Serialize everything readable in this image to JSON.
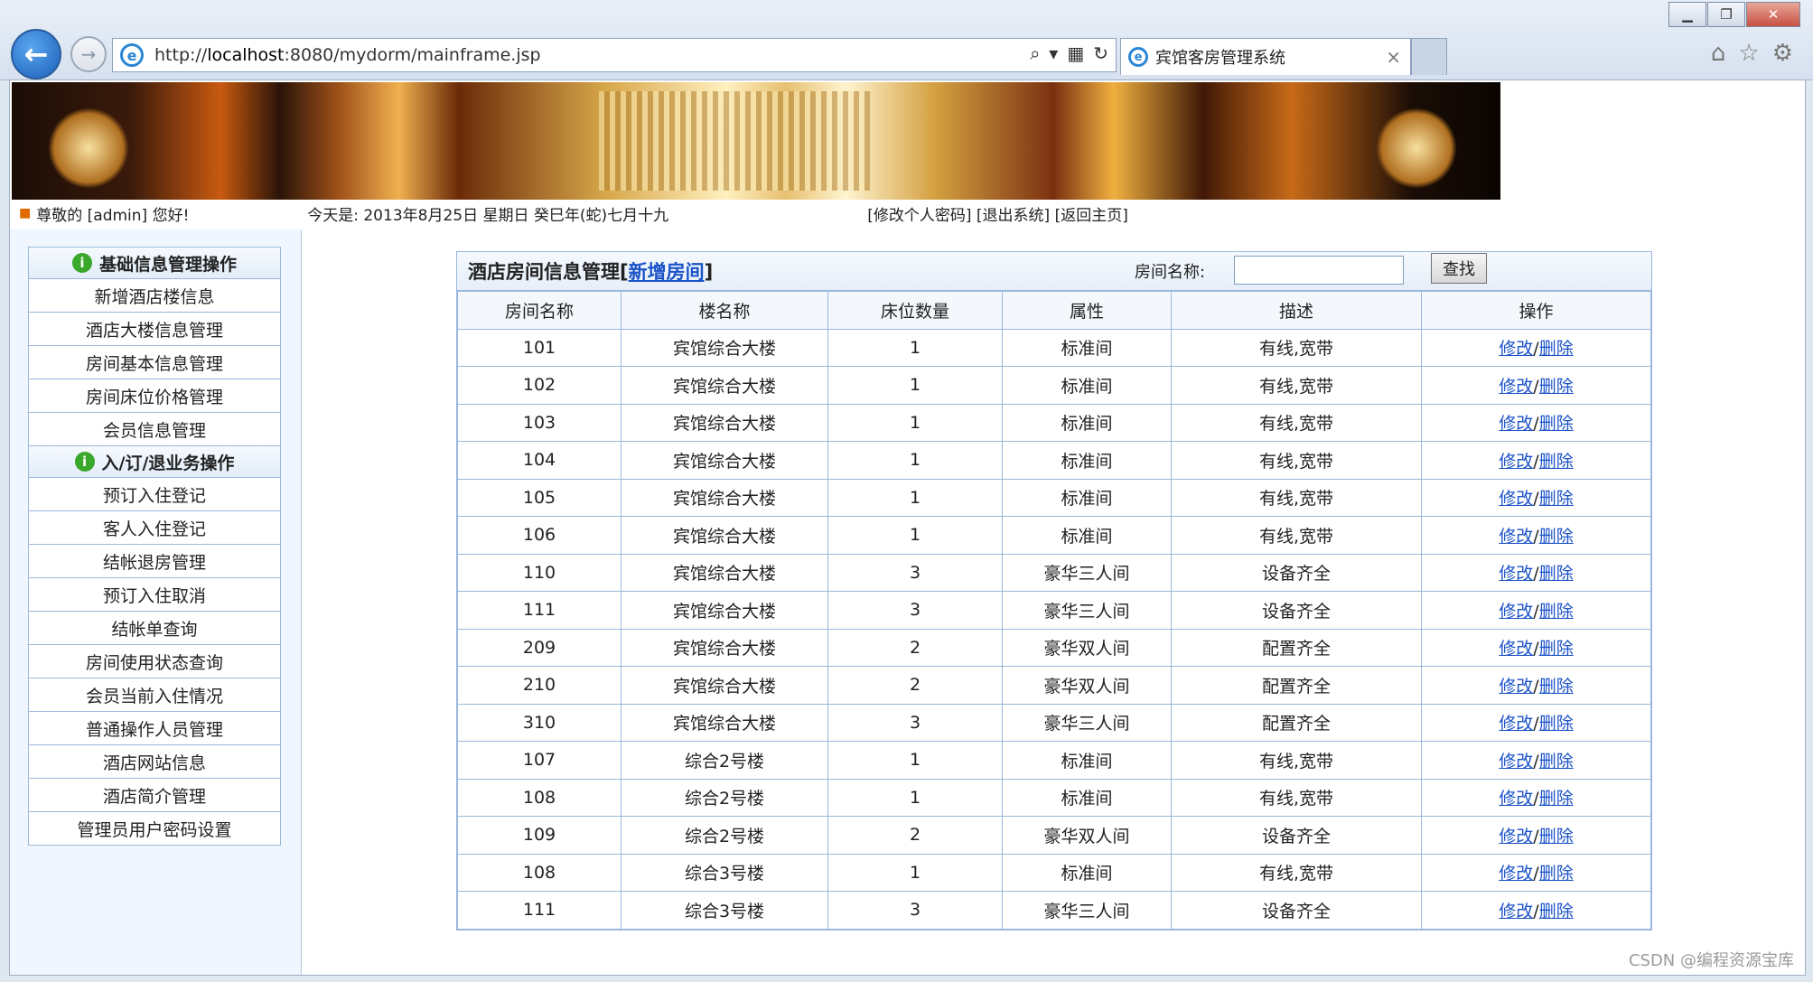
{
  "browser": {
    "url_prefix": "http://",
    "url_host": "localhost",
    "url_rest": ":8080/mydorm/mainframe.jsp",
    "tab_title": "宾馆客房管理系统",
    "tab_close": "×",
    "window_min": "▁",
    "window_max": "❐",
    "window_close": "✕"
  },
  "statusbar": {
    "greeting": "尊敬的 [admin] 您好!",
    "date": "今天是: 2013年8月25日 星期日 癸巳年(蛇)七月十九",
    "links": "[修改个人密码] [退出系统] [返回主页]"
  },
  "sidebar": {
    "section1_title": "基础信息管理操作",
    "section1_items": [
      "新增酒店楼信息",
      "酒店大楼信息管理",
      "房间基本信息管理",
      "房间床位价格管理",
      "会员信息管理"
    ],
    "section2_title": "入/订/退业务操作",
    "section2_items": [
      "预订入住登记",
      "客人入住登记",
      "结帐退房管理",
      "预订入住取消",
      "结帐单查询",
      "房间使用状态查询",
      "会员当前入住情况",
      "普通操作人员管理",
      "酒店网站信息",
      "酒店简介管理",
      "管理员用户密码设置"
    ]
  },
  "main": {
    "title": "酒店房间信息管理",
    "add_link": "新增房间",
    "bracket_open": "[",
    "bracket_close": "]",
    "search_label": "房间名称:",
    "search_button": "查找",
    "columns": [
      "房间名称",
      "楼名称",
      "床位数量",
      "属性",
      "描述",
      "操作"
    ],
    "edit_label": "修改",
    "delete_label": "删除",
    "rows": [
      [
        "101",
        "宾馆综合大楼",
        "1",
        "标准间",
        "有线,宽带"
      ],
      [
        "102",
        "宾馆综合大楼",
        "1",
        "标准间",
        "有线,宽带"
      ],
      [
        "103",
        "宾馆综合大楼",
        "1",
        "标准间",
        "有线,宽带"
      ],
      [
        "104",
        "宾馆综合大楼",
        "1",
        "标准间",
        "有线,宽带"
      ],
      [
        "105",
        "宾馆综合大楼",
        "1",
        "标准间",
        "有线,宽带"
      ],
      [
        "106",
        "宾馆综合大楼",
        "1",
        "标准间",
        "有线,宽带"
      ],
      [
        "110",
        "宾馆综合大楼",
        "3",
        "豪华三人间",
        "设备齐全"
      ],
      [
        "111",
        "宾馆综合大楼",
        "3",
        "豪华三人间",
        "设备齐全"
      ],
      [
        "209",
        "宾馆综合大楼",
        "2",
        "豪华双人间",
        "配置齐全"
      ],
      [
        "210",
        "宾馆综合大楼",
        "2",
        "豪华双人间",
        "配置齐全"
      ],
      [
        "310",
        "宾馆综合大楼",
        "3",
        "豪华三人间",
        "配置齐全"
      ],
      [
        "107",
        "综合2号楼",
        "1",
        "标准间",
        "有线,宽带"
      ],
      [
        "108",
        "综合2号楼",
        "1",
        "标准间",
        "有线,宽带"
      ],
      [
        "109",
        "综合2号楼",
        "2",
        "豪华双人间",
        "设备齐全"
      ],
      [
        "108",
        "综合3号楼",
        "1",
        "标准间",
        "有线,宽带"
      ],
      [
        "111",
        "综合3号楼",
        "3",
        "豪华三人间",
        "设备齐全"
      ]
    ]
  },
  "watermark": "CSDN @编程资源宝库"
}
